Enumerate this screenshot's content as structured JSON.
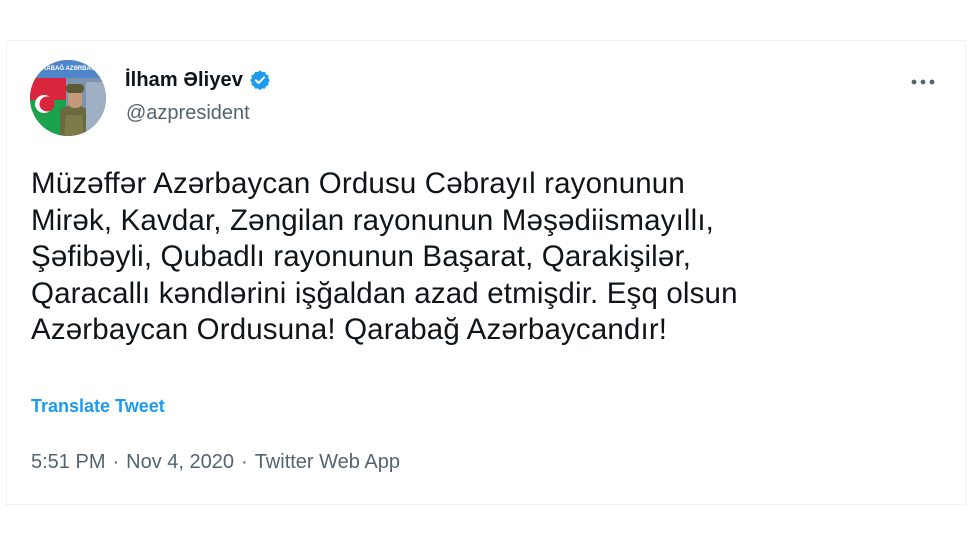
{
  "tweet": {
    "author": {
      "display_name": "İlham Əliyev",
      "handle": "@azpresident",
      "verified_icon": "verified-badge-icon",
      "avatar_banner_text": "QARABAĞ AZƏRBAYCANDIR"
    },
    "more_icon": "more-horizontal-icon",
    "text": "Müzəffər Azərbaycan Ordusu Cəbrayıl rayonunun\nMirək, Kavdar, Zəngilan rayonunun Məşədiismayıllı,\nŞəfibəyli, Qubadlı rayonunun Başarat, Qarakişilər,\nQaracallı kəndlərini işğaldan azad etmişdir. Eşq olsun\nAzərbaycan Ordusuna! Qarabağ Azərbaycandır!",
    "translate_label": "Translate Tweet",
    "time": "5:51 PM",
    "date": "Nov 4, 2020",
    "source": "Twitter Web App",
    "separator": "·"
  },
  "colors": {
    "text_primary": "#0f1419",
    "text_secondary": "#536471",
    "link": "#1d9bf0",
    "verified": "#1d9bf0",
    "border": "#eff3f4"
  }
}
